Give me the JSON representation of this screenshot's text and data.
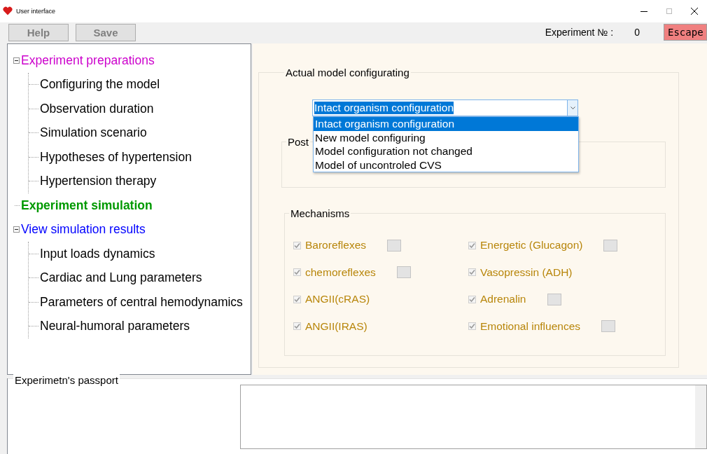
{
  "window": {
    "title": "User interface"
  },
  "toolbar": {
    "buttons": [
      {
        "label": "Help",
        "disabled": true
      },
      {
        "label": "Save",
        "disabled": true
      }
    ],
    "experiment_label": "Experiment № :",
    "experiment_number": "0",
    "escape_button": "Escape"
  },
  "tree": [
    {
      "label": "Experiment preparations",
      "color": "#cc00cc",
      "bold": false,
      "expanded": true,
      "children": [
        {
          "label": "Configuring the model"
        },
        {
          "label": "Observation duration"
        },
        {
          "label": "Simulation scenario"
        },
        {
          "label": "Hypotheses of hypertension"
        },
        {
          "label": "Hypertension therapy"
        }
      ]
    },
    {
      "label": "Experiment simulation",
      "color": "#009900",
      "bold": true
    },
    {
      "label": "View simulation results",
      "color": "#0000ff",
      "bold": false,
      "expanded": true,
      "children": [
        {
          "label": "Input loads dynamics"
        },
        {
          "label": "Cardiac and Lung parameters"
        },
        {
          "label": "Parameters of central hemodynamics"
        },
        {
          "label": "Neural-humoral parameters"
        }
      ]
    }
  ],
  "model_config": {
    "title": "Actual model configurating",
    "combo_value": "Intact organism configuration",
    "options": [
      {
        "label": "Intact organism configuration",
        "selected": true
      },
      {
        "label": "New model configuring",
        "selected": false
      },
      {
        "label": "Model configuration not changed",
        "selected": false
      },
      {
        "label": "Model of uncontroled CVS",
        "selected": false
      }
    ],
    "post_group_title": "Post"
  },
  "mechanisms": {
    "title": "Mechanisms",
    "items": [
      {
        "label": "Baroreflexes",
        "checked": true,
        "indicator": true
      },
      {
        "label": "Energetic (Glucagon)",
        "checked": true,
        "indicator": true
      },
      {
        "label": "chemoreflexes",
        "checked": true,
        "indicator": true
      },
      {
        "label": "Vasopressin (ADH)",
        "checked": true,
        "indicator": false
      },
      {
        "label": "ANGII(cRAS)",
        "checked": true,
        "indicator": false
      },
      {
        "label": "Adrenalin",
        "checked": true,
        "indicator": true
      },
      {
        "label": "ANGII(IRAS)",
        "checked": true,
        "indicator": false
      },
      {
        "label": "Emotional influences",
        "checked": true,
        "indicator": true
      }
    ]
  },
  "passport": {
    "title": "Experimetn's passport"
  }
}
